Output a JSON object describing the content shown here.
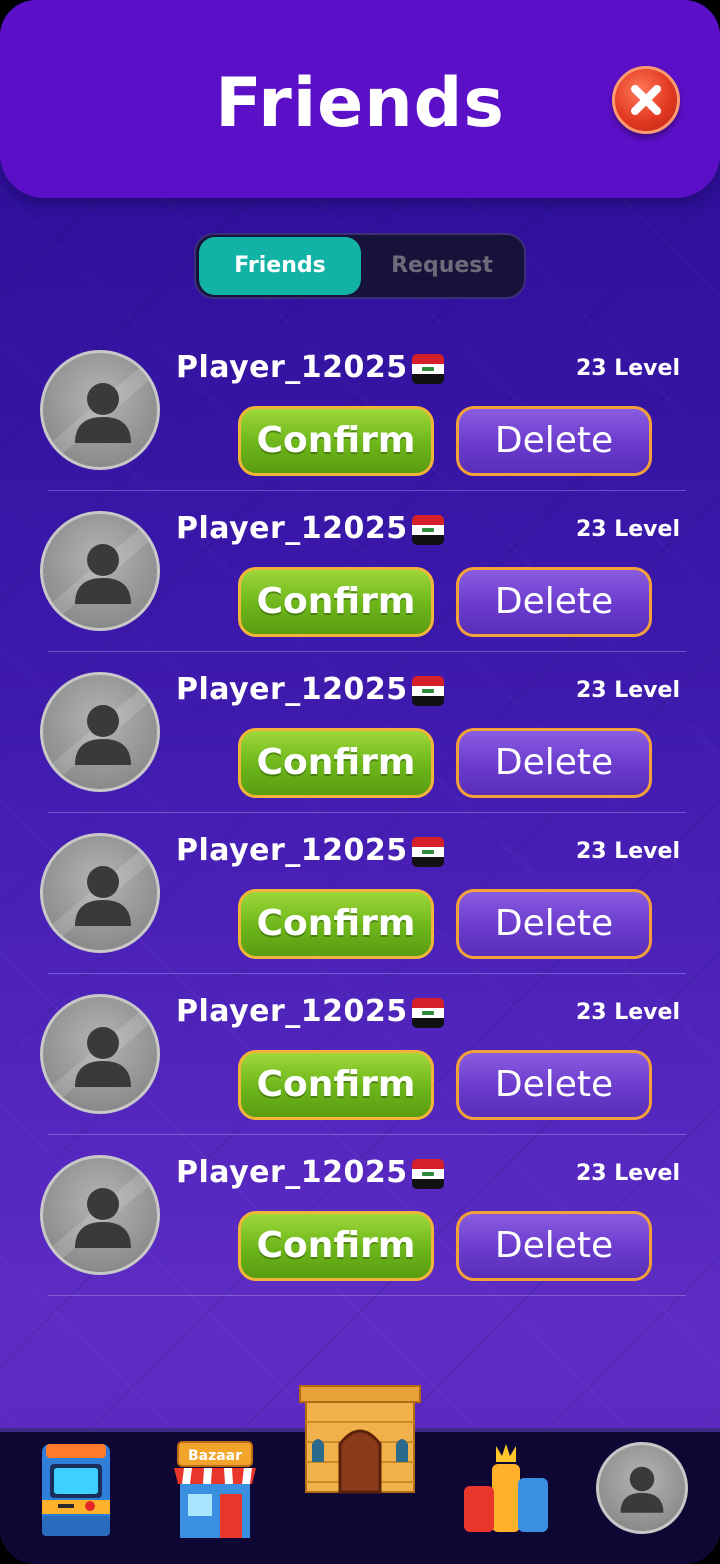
{
  "header": {
    "title": "Friends",
    "close_icon": "close-icon"
  },
  "tabs": [
    {
      "label": "Friends",
      "active": true
    },
    {
      "label": "Request",
      "active": false
    }
  ],
  "requests": [
    {
      "name": "Player_12025",
      "level": "23 Level",
      "flag": "iraq-flag-icon"
    },
    {
      "name": "Player_12025",
      "level": "23 Level",
      "flag": "iraq-flag-icon"
    },
    {
      "name": "Player_12025",
      "level": "23 Level",
      "flag": "iraq-flag-icon"
    },
    {
      "name": "Player_12025",
      "level": "23 Level",
      "flag": "iraq-flag-icon"
    },
    {
      "name": "Player_12025",
      "level": "23 Level",
      "flag": "iraq-flag-icon"
    },
    {
      "name": "Player_12025",
      "level": "23 Level",
      "flag": "iraq-flag-icon"
    }
  ],
  "actions": {
    "confirm_label": "Confirm",
    "delete_label": "Delete"
  },
  "bottom_nav": {
    "items": [
      "arcade-icon",
      "bazaar-shop-icon",
      "home-palace-icon",
      "leaderboard-icon",
      "profile-avatar-icon"
    ],
    "bazaar_sign": "Bazaar"
  },
  "colors": {
    "header": "#5b10c8",
    "accent_tab": "#12b3a6",
    "confirm": "#6cb51a",
    "delete": "#6a3bcc",
    "close": "#e23a22"
  }
}
